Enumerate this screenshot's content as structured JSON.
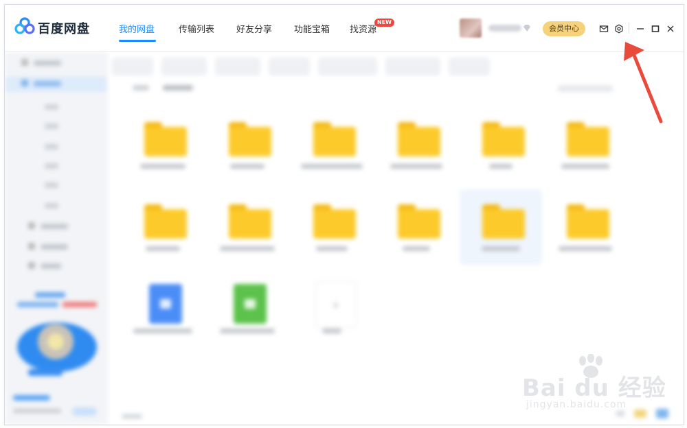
{
  "app": {
    "name": "百度网盘"
  },
  "nav": {
    "tabs": [
      {
        "label": "我的网盘",
        "active": true
      },
      {
        "label": "传输列表",
        "active": false
      },
      {
        "label": "好友分享",
        "active": false
      },
      {
        "label": "功能宝箱",
        "active": false
      },
      {
        "label": "找资源",
        "active": false,
        "badge": "NEW"
      }
    ]
  },
  "header": {
    "vip_label": "会员中心",
    "icons": [
      "mail-icon",
      "settings-icon",
      "minimize-icon",
      "maximize-icon",
      "close-icon"
    ]
  },
  "colors": {
    "accent": "#1a8cff",
    "vip": "#f6d37a",
    "folder": "#fcca2a",
    "badge": "#f0463e",
    "annotation_arrow": "#e84a3c"
  },
  "watermark": {
    "brand": "Bai du 经验",
    "url": "jingyan.baidu.com"
  }
}
